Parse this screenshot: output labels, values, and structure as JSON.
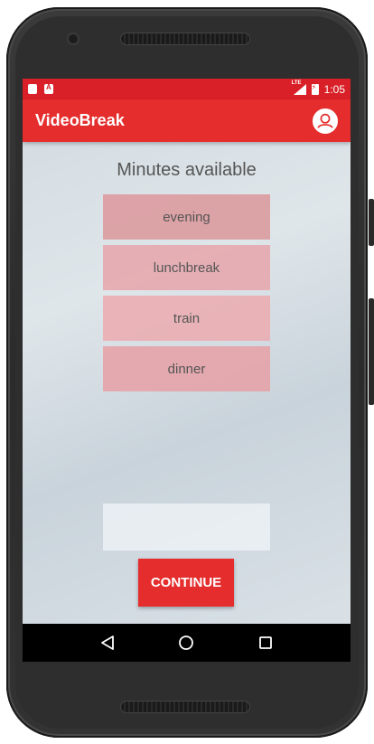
{
  "status_bar": {
    "network": "LTE",
    "time": "1:05"
  },
  "app_bar": {
    "title": "VideoBreak",
    "profile_icon": "account-circle-icon"
  },
  "main": {
    "heading": "Minutes available",
    "options": [
      {
        "label": "evening"
      },
      {
        "label": "lunchbreak"
      },
      {
        "label": "train"
      },
      {
        "label": "dinner"
      }
    ],
    "input": {
      "value": "",
      "placeholder": ""
    },
    "continue_label": "CONTINUE"
  },
  "nav_bar": {
    "back_icon": "back-triangle-icon",
    "home_icon": "home-circle-icon",
    "recents_icon": "recents-square-icon"
  },
  "colors": {
    "accent": "#e52d2d",
    "status_bar": "#d91f27",
    "option_fill": "#e8a0a5"
  }
}
